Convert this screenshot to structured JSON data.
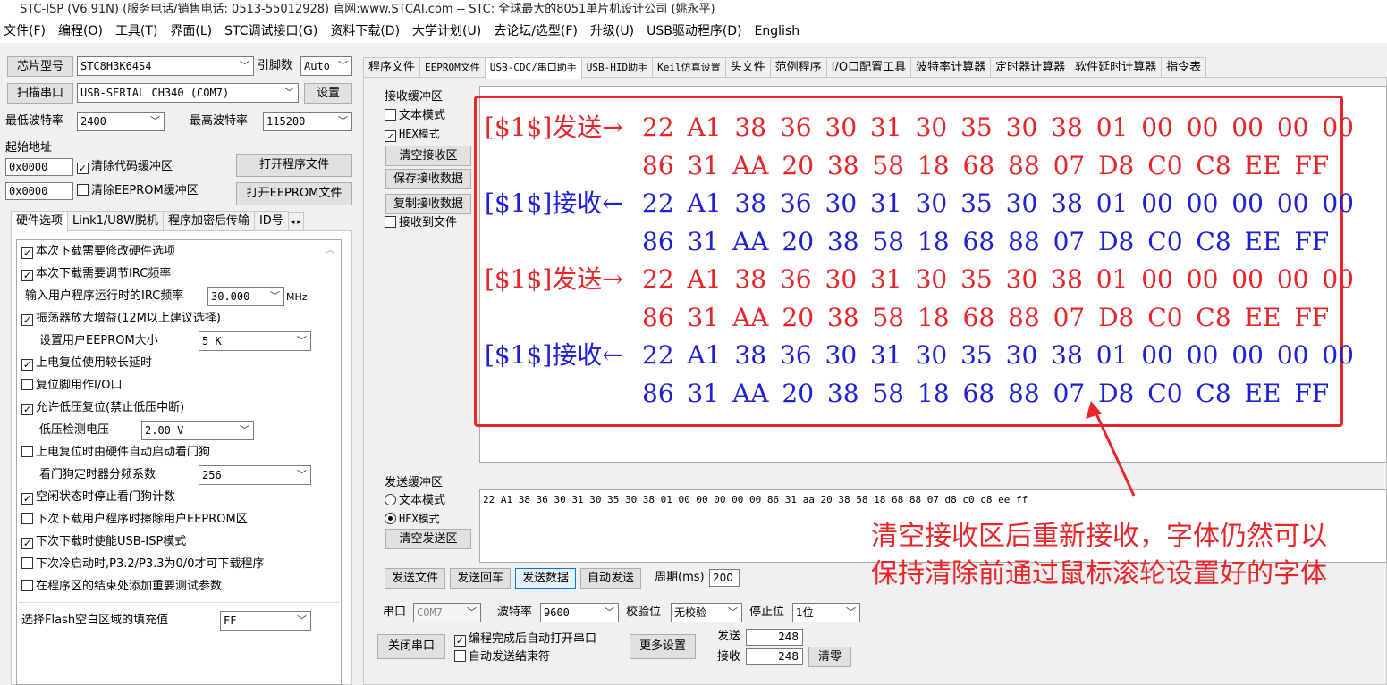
{
  "window": {
    "title": "STC-ISP (V6.91N) (服务电话/销售电话: 0513-55012928) 官网:www.STCAI.com  -- STC: 全球最大的8051单片机设计公司 (姚永平)"
  },
  "menu": [
    "文件(F)",
    "编程(O)",
    "工具(T)",
    "界面(L)",
    "STC调试接口(G)",
    "资料下载(D)",
    "大学计划(U)",
    "去论坛/选型(F)",
    "升级(U)",
    "USB驱动程序(D)",
    "English"
  ],
  "left": {
    "chip_label": "芯片型号",
    "chip_value": "STC8H3K64S4",
    "pin_label": "引脚数",
    "pin_value": "Auto",
    "scan_button": "扫描串口",
    "port_value": "USB-SERIAL CH340 (COM7)",
    "settings_button": "设置",
    "min_baud_label": "最低波特率",
    "min_baud_value": "2400",
    "max_baud_label": "最高波特率",
    "max_baud_value": "115200",
    "start_addr_label": "起始地址",
    "addr1": "0x0000",
    "clear_code_label": "清除代码缓冲区",
    "open_prog_button": "打开程序文件",
    "addr2": "0x0000",
    "clear_eeprom_label": "清除EEPROM缓冲区",
    "open_eeprom_button": "打开EEPROM文件",
    "tabs": [
      "硬件选项",
      "Link1/U8W脱机",
      "程序加密后传输",
      "ID号"
    ],
    "hw": {
      "opt1": "本次下载需要修改硬件选项",
      "opt2": "本次下载需要调节IRC频率",
      "irc_label": "输入用户程序运行时的IRC频率",
      "irc_value": "30.000",
      "irc_unit": "MHz",
      "opt3": "振荡器放大增益(12M以上建议选择)",
      "eeprom_label": "设置用户EEPROM大小",
      "eeprom_value": "5   K",
      "opt4": "上电复位使用较长延时",
      "opt5": "复位脚用作I/O口",
      "opt6": "允许低压复位(禁止低压中断)",
      "lvd_label": "低压检测电压",
      "lvd_value": "2.00 V",
      "opt7": "上电复位时由硬件自动启动看门狗",
      "wdt_label": "看门狗定时器分频系数",
      "wdt_value": "256",
      "opt8": "空闲状态时停止看门狗计数",
      "opt9": "下次下载用户程序时擦除用户EEPROM区",
      "opt10": "下次下载时使能USB-ISP模式",
      "opt11": "下次冷启动时,P3.2/P3.3为0/0才可下载程序",
      "opt12": "在程序区的结束处添加重要测试参数",
      "fill_label": "选择Flash空白区域的填充值",
      "fill_value": "FF"
    }
  },
  "right_tabs": [
    "程序文件",
    "EEPROM文件",
    "USB-CDC/串口助手",
    "USB-HID助手",
    "Keil仿真设置",
    "头文件",
    "范例程序",
    "I/O口配置工具",
    "波特率计算器",
    "定时器计算器",
    "软件延时计算器",
    "指令表"
  ],
  "receive": {
    "group_label": "接收缓冲区",
    "text_mode": "文本模式",
    "hex_mode": "HEX模式",
    "clear_button": "清空接收区",
    "save_button": "保存接收数据",
    "copy_button": "复制接收数据",
    "to_file": "接收到文件",
    "lines": [
      {
        "prefix": "[$1$]发送→",
        "data": "22 A1 38 36 30 31 30 35 30 38 01 00 00 00 00 00",
        "color": "red"
      },
      {
        "prefix": "",
        "data": "86 31 AA 20 38 58 18 68 88 07 D8 C0 C8 EE FF",
        "color": "red"
      },
      {
        "prefix": "[$1$]接收←",
        "data": "22 A1 38 36 30 31 30 35 30 38 01 00 00 00 00 00",
        "color": "blue"
      },
      {
        "prefix": "",
        "data": "86 31 AA 20 38 58 18 68 88 07 D8 C0 C8 EE FF",
        "color": "blue"
      },
      {
        "prefix": "[$1$]发送→",
        "data": "22 A1 38 36 30 31 30 35 30 38 01 00 00 00 00 00",
        "color": "red"
      },
      {
        "prefix": "",
        "data": "86 31 AA 20 38 58 18 68 88 07 D8 C0 C8 EE FF",
        "color": "red"
      },
      {
        "prefix": "[$1$]接收←",
        "data": "22 A1 38 36 30 31 30 35 30 38 01 00 00 00 00 00",
        "color": "blue"
      },
      {
        "prefix": "",
        "data": "86 31 AA 20 38 58 18 68 88 07 D8 C0 C8 EE FF",
        "color": "blue"
      }
    ]
  },
  "send": {
    "group_label": "发送缓冲区",
    "text_mode": "文本模式",
    "hex_mode": "HEX模式",
    "clear_button": "清空发送区",
    "content": "22 A1 38 36 30 31 30 35 30 38 01 00 00 00 00 00 86 31 aa 20 38 58 18 68 88 07 d8 c0 c8 ee ff",
    "send_file": "发送文件",
    "send_enter": "发送回车",
    "send_data": "发送数据",
    "auto_send": "自动发送",
    "period_label": "周期(ms)",
    "period_value": "200"
  },
  "serial": {
    "port_label": "串口",
    "port_value": "COM7",
    "baud_label": "波特率",
    "baud_value": "9600",
    "parity_label": "校验位",
    "parity_value": "无校验",
    "stop_label": "停止位",
    "stop_value": "1位",
    "close_button": "关闭串口",
    "auto_open": "编程完成后自动打开串口",
    "auto_end": "自动发送结束符",
    "more_button": "更多设置",
    "sent_label": "发送",
    "sent_value": "248",
    "recv_label": "接收",
    "recv_value": "248",
    "clear_count_button": "清零"
  },
  "annotation": {
    "line1": "清空接收区后重新接收，字体仍然可以",
    "line2": "保持清除前通过鼠标滚轮设置好的字体",
    "color": "#e8262a"
  }
}
